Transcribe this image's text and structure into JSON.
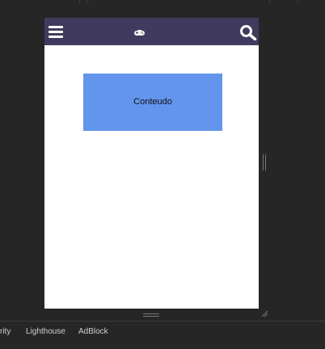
{
  "devtools": {
    "tabs": [
      {
        "label": "rity"
      },
      {
        "label": "Lighthouse"
      },
      {
        "label": "AdBlock"
      }
    ]
  },
  "app": {
    "header": {
      "background": "#403b5e",
      "menu_icon": "hamburger-menu-icon",
      "logo_icon": "game-controller-icon",
      "search_icon": "search-icon"
    },
    "content": {
      "label": "Conteudo",
      "background": "#6495ed"
    }
  }
}
